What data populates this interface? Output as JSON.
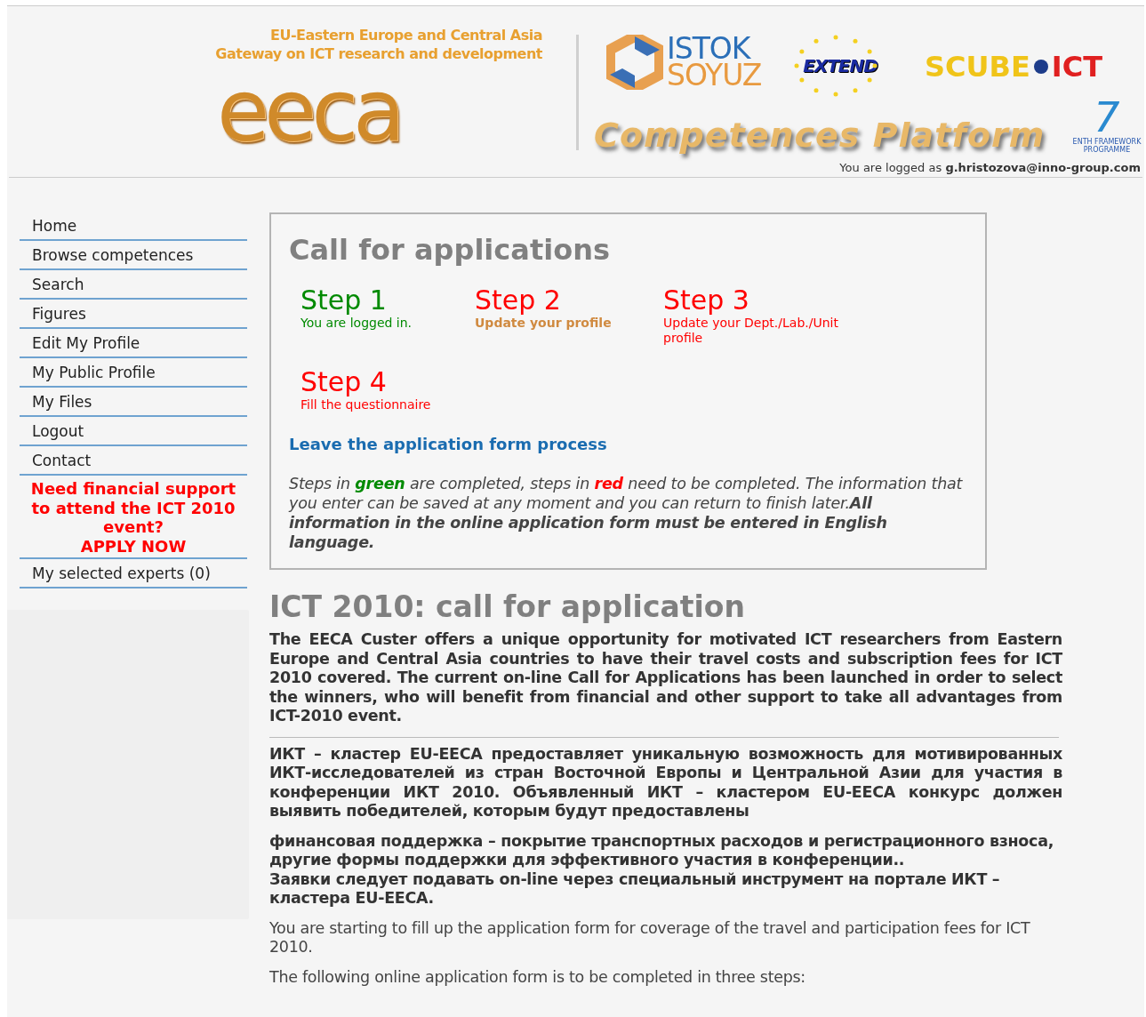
{
  "header": {
    "tagline_1": "EU-Eastern Europe and Central Asia",
    "tagline_2": "Gateway on ICT research and development",
    "eeca_logo": "eeca",
    "partners": [
      {
        "kind": "istok",
        "line_1": "ISTOK",
        "line_2": "SOYUZ"
      },
      {
        "kind": "extend",
        "line_1": "EXTEND"
      },
      {
        "kind": "scube",
        "line_1": "SCUBE",
        "line_2": "ICT"
      }
    ],
    "platform_title": "Competences Platform",
    "fp7_logo": {
      "numeral": "7",
      "line_1": "ENTH FRAMEWORK",
      "line_2": "PROGRAMME"
    },
    "login_prefix": "You are logged as",
    "login_user": "g.hristozova@inno-group.com"
  },
  "sidebar": {
    "items": [
      {
        "kind": "link",
        "label": "Home"
      },
      {
        "kind": "link",
        "label": "Browse competences"
      },
      {
        "kind": "link",
        "label": "Search"
      },
      {
        "kind": "link",
        "label": "Figures"
      },
      {
        "kind": "link",
        "label": "Edit My Profile"
      },
      {
        "kind": "link",
        "label": "My Public Profile"
      },
      {
        "kind": "link",
        "label": "My Files"
      },
      {
        "kind": "link",
        "label": "Logout"
      },
      {
        "kind": "link",
        "label": "Contact"
      },
      {
        "kind": "promo",
        "label": "Need financial support to attend the ICT 2010 event?",
        "action": "APPLY NOW"
      },
      {
        "kind": "link",
        "label": "My selected experts (0)"
      }
    ]
  },
  "call_box": {
    "title": "Call for applications",
    "steps": [
      {
        "label": "Step 1",
        "description": "You are logged in.",
        "completed": true,
        "current": false
      },
      {
        "label": "Step 2",
        "description": "Update your profile",
        "completed": false,
        "current": true
      },
      {
        "label": "Step 3",
        "description": "Update your Dept./Lab./Unit profile",
        "completed": false,
        "current": false
      },
      {
        "label": "Step 4",
        "description": "Fill the questionnaire",
        "completed": false,
        "current": false
      }
    ],
    "leave_link": "Leave the application form process",
    "note_parts": [
      {
        "kind": "plain",
        "text": "Steps in "
      },
      {
        "kind": "green",
        "text": "green"
      },
      {
        "kind": "plain",
        "text": " are completed, steps in "
      },
      {
        "kind": "red",
        "text": "red"
      },
      {
        "kind": "plain",
        "text": " need to be completed. The information that you enter can be saved at any moment and you can return to finish later."
      },
      {
        "kind": "bold",
        "text": "All information in the online application form must be entered in English language."
      }
    ]
  },
  "article": {
    "title": "ICT 2010: call for application",
    "intro": "The EECA Custer offers a unique opportunity for motivated ICT researchers from Eastern Europe and Central Asia countries to have their travel costs and subscription fees for ICT 2010 covered. The current on-line Call for Applications has been launched in order to select the winners, who will benefit from financial and other support to take all advantages from ICT-2010 event.",
    "russian_intro": "ИКТ – кластер EU-EECA предоставляет уникальную возможность для мотивированных ИКТ-исследователей из стран Восточной Европы и Центральной Азии для участия в конференции ИКТ 2010. Объявленный ИКТ – кластером EU-EECA конкурс должен выявить победителей, которым будут предоставлены",
    "russian_lines": [
      "финансовая поддержка – покрытие транспортных расходов и регистрационного взноса,",
      "другие формы поддержки для эффективного участия в конференции..",
      "Заявки следует подавать on-line через специальный инструмент на портале ИКТ – кластера EU-EECA."
    ],
    "paragraphs": [
      "You are starting to fill up the application form for coverage of the travel and participation fees for ICT 2010.",
      "The following online application form is to be completed in three steps:"
    ]
  }
}
